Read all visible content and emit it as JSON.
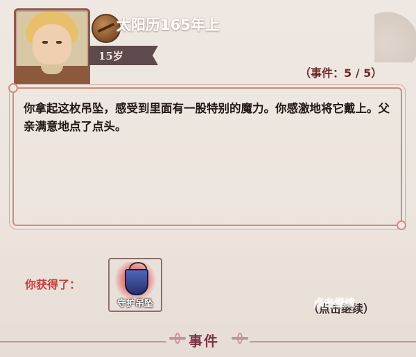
{
  "header": {
    "date_title": "太阳历165年上",
    "age": "15岁",
    "event_count": "（事件：5 / 5）"
  },
  "event": {
    "text": "你拿起这枚吊坠，感受到里面有一股特别的魔力。你感激地将它戴上。父亲满意地点了点头。"
  },
  "reward": {
    "label": "你获得了：",
    "item_name": "守护吊坠"
  },
  "actions": {
    "continue_label": "（点击继续）",
    "continue_overlay": "点击继续"
  },
  "footer": {
    "title": "事件"
  },
  "colors": {
    "accent_red": "#c93c3c",
    "frame_pink": "#c98f7c",
    "footer_text": "#7a3245"
  },
  "icons": {
    "coin": "coin-icon",
    "amulet": "amulet-icon"
  }
}
